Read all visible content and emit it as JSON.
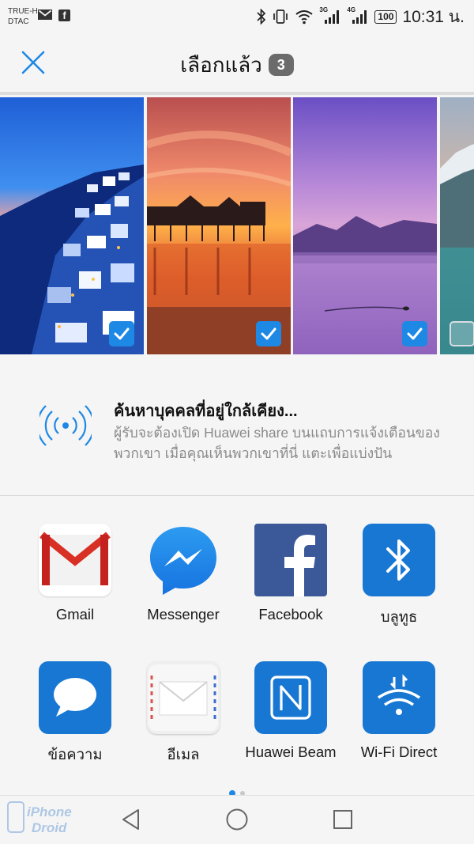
{
  "status_bar": {
    "carrier_1": "TRUE-H",
    "carrier_2": "DTAC",
    "notification_icons": [
      "gmail-icon",
      "facebook-icon"
    ],
    "network_1": "3G",
    "network_2": "4G",
    "battery": "100",
    "time": "10:31 น."
  },
  "header": {
    "close_icon": "close-icon",
    "title": "เลือกแล้ว",
    "selected_count": "3"
  },
  "photos": [
    {
      "name": "santorini-night",
      "selected": true
    },
    {
      "name": "pier-sunset",
      "selected": true
    },
    {
      "name": "purple-lake",
      "selected": true
    },
    {
      "name": "mountain-lake",
      "selected": false
    }
  ],
  "nearby": {
    "icon": "wireless-signal-icon",
    "title": "ค้นหาบุคคลที่อยู่ใกล้เคียง...",
    "description": "ผู้รับจะต้องเปิด Huawei share บนแถบการแจ้งเตือนของพวกเขา เมื่อคุณเห็นพวกเขาที่นี่ แตะเพื่อแบ่งปัน"
  },
  "apps": [
    {
      "label": "Gmail",
      "icon": "gmail-icon"
    },
    {
      "label": "Messenger",
      "icon": "messenger-icon"
    },
    {
      "label": "Facebook",
      "icon": "facebook-icon"
    },
    {
      "label": "บลูทูธ",
      "icon": "bluetooth-icon"
    },
    {
      "label": "ข้อความ",
      "icon": "message-icon"
    },
    {
      "label": "อีเมล",
      "icon": "email-icon"
    },
    {
      "label": "Huawei Beam",
      "icon": "nfc-icon"
    },
    {
      "label": "Wi-Fi Direct",
      "icon": "wifi-direct-icon"
    }
  ],
  "pager": {
    "pages": 2,
    "current": 1
  },
  "nav_bar": {
    "back": "back-icon",
    "home": "home-icon",
    "recents": "recents-icon"
  },
  "watermark": {
    "line_1": "iPhone",
    "line_2": "Droid"
  },
  "colors": {
    "accent": "#1e88e5",
    "badge": "#6b6b6b",
    "subtext": "#8a8a8a"
  }
}
